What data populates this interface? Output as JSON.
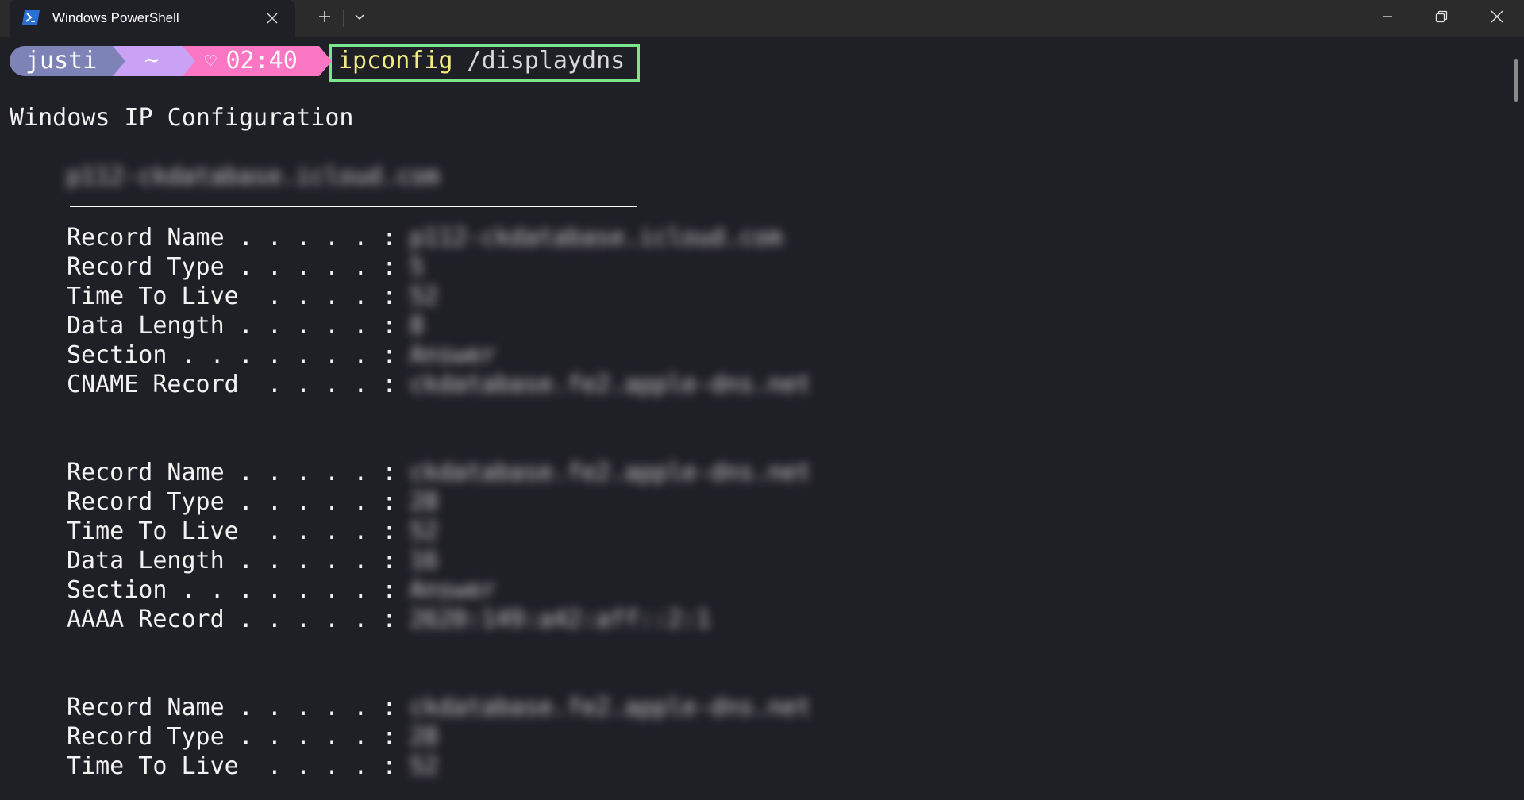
{
  "window": {
    "tab_title": "Windows PowerShell",
    "new_tab_symbol": "+",
    "icons": [
      "powershell-icon",
      "close-icon",
      "plus-icon",
      "chevron-down-icon",
      "minimize-icon",
      "maximize-icon",
      "window-close-icon"
    ]
  },
  "prompt": {
    "user": "justi",
    "dir": "~",
    "time_icon": "♡",
    "time": "02:40",
    "colors": {
      "user_bg": "#7d83b6",
      "dir_bg": "#c9a2f6",
      "time_bg": "#fb77c4",
      "highlight_border": "#7be58c",
      "command_color": "#f2ec82"
    }
  },
  "command": {
    "name": "ipconfig",
    "args": " /displaydns"
  },
  "output": {
    "header": "Windows IP Configuration",
    "entry_name": "p112-ckdatabase.icloud.com",
    "records": [
      {
        "fields": [
          {
            "label": "Record Name . . . . . :",
            "value": "p112-ckdatabase.icloud.com"
          },
          {
            "label": "Record Type . . . . . :",
            "value": "5"
          },
          {
            "label": "Time To Live  . . . . :",
            "value": "52"
          },
          {
            "label": "Data Length . . . . . :",
            "value": "8"
          },
          {
            "label": "Section . . . . . . . :",
            "value": "Answer"
          },
          {
            "label": "CNAME Record  . . . . :",
            "value": "ckdatabase.fe2.apple-dns.net"
          }
        ]
      },
      {
        "fields": [
          {
            "label": "Record Name . . . . . :",
            "value": "ckdatabase.fe2.apple-dns.net"
          },
          {
            "label": "Record Type . . . . . :",
            "value": "28"
          },
          {
            "label": "Time To Live  . . . . :",
            "value": "52"
          },
          {
            "label": "Data Length . . . . . :",
            "value": "16"
          },
          {
            "label": "Section . . . . . . . :",
            "value": "Answer"
          },
          {
            "label": "AAAA Record . . . . . :",
            "value": "2620:149:a42:aff::2:1"
          }
        ]
      },
      {
        "fields": [
          {
            "label": "Record Name . . . . . :",
            "value": "ckdatabase.fe2.apple-dns.net"
          },
          {
            "label": "Record Type . . . . . :",
            "value": "28"
          },
          {
            "label": "Time To Live  . . . . :",
            "value": "52"
          }
        ]
      }
    ]
  }
}
